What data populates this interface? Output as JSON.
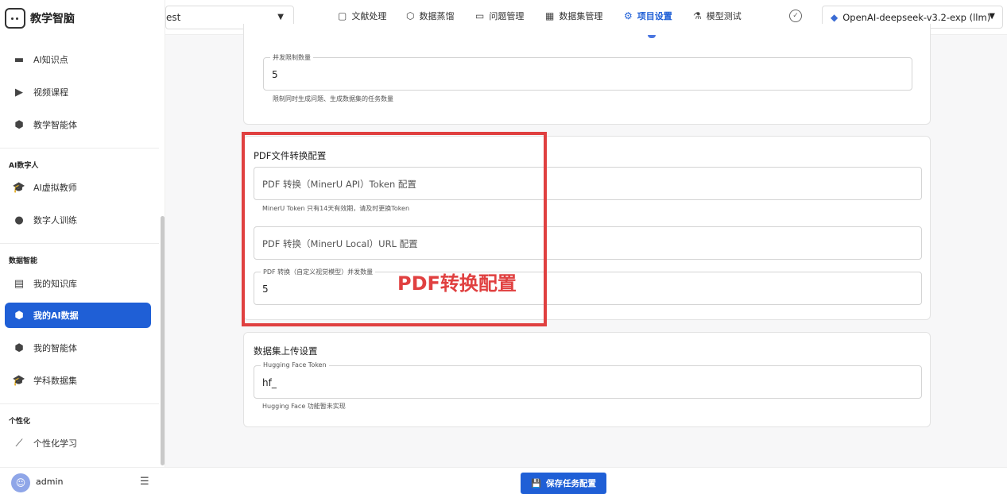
{
  "brand": {
    "title": "教学智脑"
  },
  "sidebar": {
    "items": [
      {
        "label": "AI知识点",
        "icon": "film-icon",
        "glyph": "▬"
      },
      {
        "label": "视频课程",
        "icon": "play-icon",
        "glyph": "▶"
      },
      {
        "label": "教学智能体",
        "icon": "cube-icon",
        "glyph": "⬢"
      },
      {
        "label": "AI虚拟教师",
        "icon": "graduation-cap-icon",
        "glyph": "🎓"
      },
      {
        "label": "数字人训练",
        "icon": "person-icon",
        "glyph": "●"
      },
      {
        "label": "我的知识库",
        "icon": "book-icon",
        "glyph": "▤"
      },
      {
        "label": "我的AI数据",
        "icon": "package-icon",
        "glyph": "⬢"
      },
      {
        "label": "我的智能体",
        "icon": "cube-icon",
        "glyph": "⬢"
      },
      {
        "label": "学科数据集",
        "icon": "graduation-cap-icon",
        "glyph": "🎓"
      },
      {
        "label": "个性化学习",
        "icon": "magic-wand-icon",
        "glyph": "⟋"
      }
    ],
    "sections": [
      "AI数字人",
      "数据智能",
      "个性化"
    ],
    "user": {
      "name": "admin"
    }
  },
  "topbar": {
    "project_value": "est",
    "tabs": [
      {
        "label": "文献处理",
        "icon": "document-icon",
        "glyph": "▢"
      },
      {
        "label": "数据蒸馏",
        "icon": "cube-icon",
        "glyph": "⬡"
      },
      {
        "label": "问题管理",
        "icon": "chat-icon",
        "glyph": "▭"
      },
      {
        "label": "数据集管理",
        "icon": "grid-icon",
        "glyph": "▦"
      },
      {
        "label": "项目设置",
        "icon": "gear-icon",
        "glyph": "⚙"
      },
      {
        "label": "模型测试",
        "icon": "flask-icon",
        "glyph": "⚗"
      }
    ],
    "model": "OpenAI-deepseek-v3.2-exp (llm)"
  },
  "concurrency": {
    "label": "并发限制数量",
    "value": "5",
    "helper": "限制同时生成问题、生成数据集的任务数量"
  },
  "pdf": {
    "title": "PDF文件转换配置",
    "token_placeholder": "PDF 转换（MinerU API）Token 配置",
    "token_helper": "MinerU Token 只有14天有效期，请及时更换Token",
    "url_placeholder": "PDF 转换（MinerU Local）URL 配置",
    "vision_label": "PDF 转换（自定义视觉模型）并发数量",
    "vision_value": "5",
    "annotation": "PDF转换配置"
  },
  "upload": {
    "title": "数据集上传设置",
    "hf_label": "Hugging Face Token",
    "hf_value": "hf_",
    "hf_helper": "Hugging Face 功能暂未实现"
  },
  "actions": {
    "save_label": "保存任务配置"
  },
  "colors": {
    "accent": "#1f5fd6",
    "highlight": "#e04040"
  }
}
